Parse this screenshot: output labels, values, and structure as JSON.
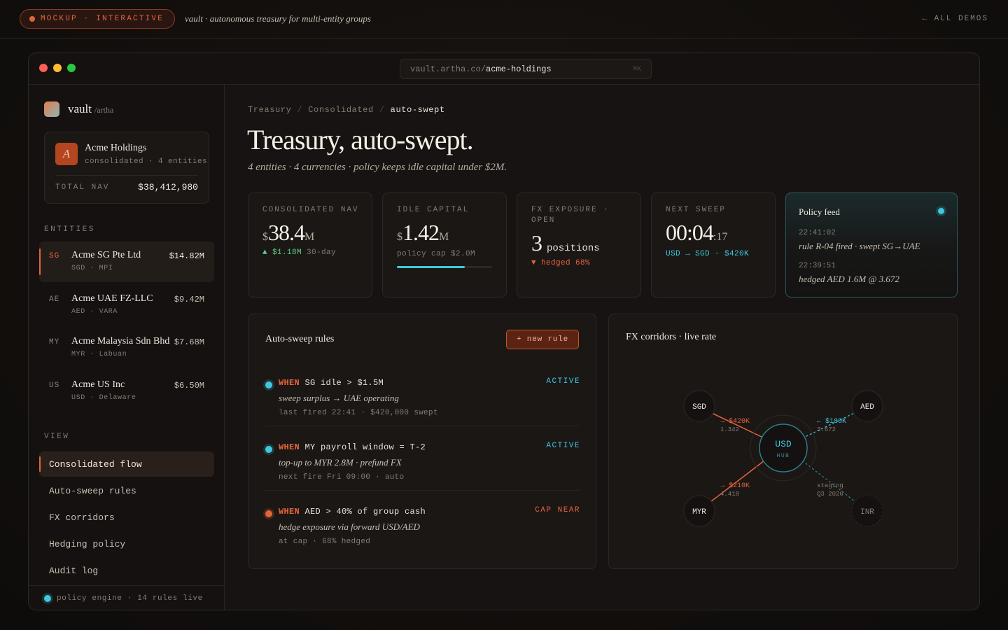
{
  "topbar": {
    "badge": "MOCKUP · INTERACTIVE",
    "tagline": "vault · autonomous treasury for multi-entity groups",
    "all_demos": "← ALL DEMOS"
  },
  "window": {
    "url_base": "vault.artha.co/",
    "url_path": "acme-holdings",
    "url_kbd": "⌘K"
  },
  "sidebar": {
    "brand": "vault",
    "brand_sub": "/artha",
    "org": {
      "avatar": "A",
      "name": "Acme Holdings",
      "meta": "consolidated · 4 entities",
      "nav_label": "TOTAL NAV",
      "nav_value": "$38,412,980"
    },
    "entities_label": "ENTITIES",
    "entities": [
      {
        "code": "SG",
        "name": "Acme SG Pte Ltd",
        "meta": "SGD · MPI",
        "value": "$14.82M"
      },
      {
        "code": "AE",
        "name": "Acme UAE FZ-LLC",
        "meta": "AED · VARA",
        "value": "$9.42M"
      },
      {
        "code": "MY",
        "name": "Acme Malaysia Sdn Bhd",
        "meta": "MYR · Labuan",
        "value": "$7.68M"
      },
      {
        "code": "US",
        "name": "Acme US Inc",
        "meta": "USD · Delaware",
        "value": "$6.50M"
      }
    ],
    "view_label": "VIEW",
    "views": [
      {
        "label": "Consolidated flow"
      },
      {
        "label": "Auto-sweep rules"
      },
      {
        "label": "FX corridors"
      },
      {
        "label": "Hedging policy"
      },
      {
        "label": "Audit log"
      }
    ],
    "footer": "policy engine · 14 rules live"
  },
  "main": {
    "breadcrumb": [
      "Treasury",
      "Consolidated",
      "auto-swept"
    ],
    "title": "Treasury, auto-swept.",
    "subtitle": "4 entities · 4 currencies · policy keeps idle capital under $2M.",
    "stats": {
      "nav": {
        "label": "CONSOLIDATED NAV",
        "currency": "$",
        "value": "38.4",
        "unit": "M",
        "delta": "▲ $1.18M",
        "delta_suffix": " 30-day"
      },
      "idle": {
        "label": "IDLE CAPITAL",
        "currency": "$",
        "value": "1.42",
        "unit": "M",
        "note": "policy cap $2.0M",
        "fill_fraction": 0.71
      },
      "fx": {
        "label": "FX EXPOSURE · OPEN",
        "value": "3",
        "unit": "positions",
        "note": "▼ hedged 68%"
      },
      "sweep": {
        "label": "NEXT SWEEP",
        "value": "00:04",
        "seconds": ":17",
        "note": "USD → SGD · $420K"
      }
    },
    "feed": {
      "title": "Policy feed",
      "items": [
        {
          "time": "22:41:02",
          "text": "rule R-04 fired · swept SG→UAE"
        },
        {
          "time": "22:39:51",
          "text": "hedged AED 1.6M @ 3.672"
        }
      ]
    },
    "rules": {
      "title": "Auto-sweep rules",
      "new_button": "+ new rule",
      "items": [
        {
          "kw": "WHEN",
          "cond": " SG idle > $1.5M",
          "status": "ACTIVE",
          "desc": "sweep surplus → UAE operating",
          "meta": "last fired 22:41 · $420,000 swept"
        },
        {
          "kw": "WHEN",
          "cond": " MY payroll window = T-2",
          "status": "ACTIVE",
          "desc": "top-up to MYR 2.8M · prefund FX",
          "meta": "next fire Fri 09:00 · auto"
        },
        {
          "kw": "WHEN",
          "cond": " AED > 40% of group cash",
          "status": "CAP NEAR",
          "desc": "hedge exposure via forward USD/AED",
          "meta": "at cap · 68% hedged"
        }
      ]
    },
    "fx": {
      "title": "FX corridors · live rate",
      "hub": "USD",
      "hub_sub": "HUB",
      "nodes": {
        "sgd": "SGD",
        "aed": "AED",
        "myr": "MYR",
        "inr": "INR"
      },
      "sgd_amount": "→ $420K",
      "sgd_rate": "1.342",
      "aed_amount": "← $180K",
      "aed_rate": "3.672",
      "myr_amount": "→ $210K",
      "myr_rate": "4.418",
      "inr_status": "staging",
      "inr_eta": "Q3 2026"
    }
  },
  "colors": {
    "accent": "#e2643c",
    "live": "#3fc8e0",
    "positive": "#5fd08a",
    "background": "#171312"
  }
}
